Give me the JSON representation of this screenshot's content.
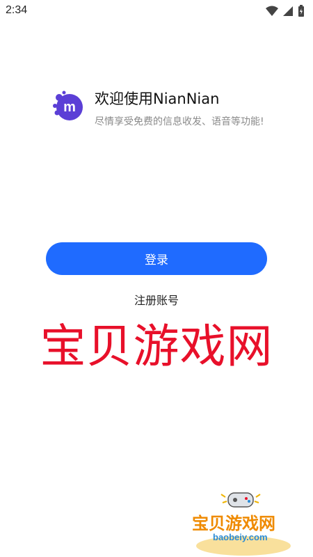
{
  "status_bar": {
    "time": "2:34",
    "icons": [
      "wifi-icon",
      "cellular-signal-icon",
      "battery-charging-icon"
    ]
  },
  "header": {
    "title": "欢迎使用NianNian",
    "subtitle": "尽情享受免费的信息收发、语音等功能!"
  },
  "actions": {
    "login_label": "登录",
    "register_label": "注册账号"
  },
  "watermark": {
    "main_text": "宝贝游戏网",
    "corner_text": "宝贝游戏网",
    "corner_site": "baobeiy.com"
  },
  "colors": {
    "primary": "#1f6bff",
    "watermark_red": "#e8102a",
    "subtitle_gray": "#8a8a8a",
    "logo_purple": "#5b3fd6"
  }
}
